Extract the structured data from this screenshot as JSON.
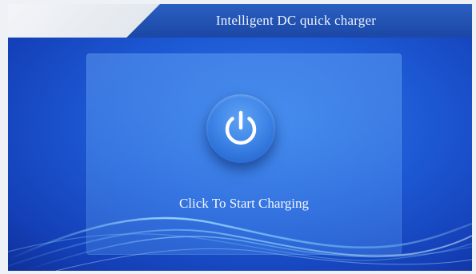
{
  "header": {
    "title": "Intelligent DC quick charger"
  },
  "main": {
    "start_label": "Click To Start Charging",
    "power_icon": "power-icon"
  },
  "colors": {
    "background": "#1d59d4",
    "header_bar": "#1b47a6",
    "panel": "#5aa0f5",
    "button": "#3f86e8",
    "text": "#f3f7ff"
  }
}
